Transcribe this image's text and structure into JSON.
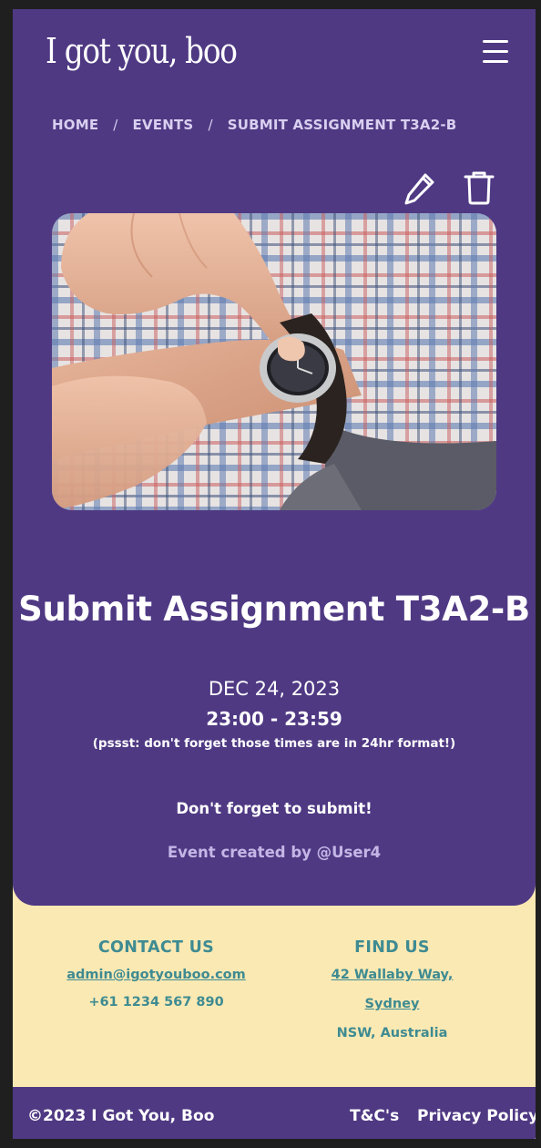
{
  "header": {
    "logo_text": "I got you, boo",
    "menu_icon": "hamburger-menu-icon"
  },
  "breadcrumb": {
    "items": [
      "HOME",
      "EVENTS",
      "SUBMIT ASSIGNMENT T3A2-B"
    ],
    "separator": "/"
  },
  "actions": {
    "edit_icon": "pencil-icon",
    "delete_icon": "trash-icon"
  },
  "event": {
    "image_alt": "Person pointing at wristwatch",
    "title": "Submit Assignment T3A2-B",
    "date": "DEC 24, 2023",
    "time": "23:00 - 23:59",
    "time_hint": "(pssst: don't forget those times are in 24hr format!)",
    "description": "Don't forget to submit!",
    "created_by": "Event created by @User4"
  },
  "contact": {
    "heading": "CONTACT US",
    "email": "admin@igotyouboo.com",
    "phone": "+61 1234 567 890"
  },
  "find": {
    "heading": "FIND US",
    "address_line1": "42 Wallaby Way,",
    "address_line2": "Sydney",
    "address_line3": "NSW, Australia"
  },
  "footer": {
    "copyright": "©2023 I Got You, Boo",
    "tcs": "T&C's",
    "privacy": "Privacy Policy"
  },
  "colors": {
    "primary_purple": "#4f3983",
    "cream": "#fbe9b3",
    "teal": "#3e8b92",
    "breadcrumb": "#d9cff0",
    "creator_text": "#c4b6e6"
  }
}
